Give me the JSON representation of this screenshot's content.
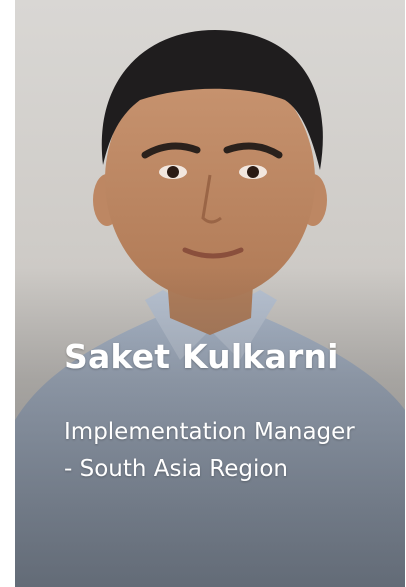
{
  "profile": {
    "name": "Saket Kulkarni",
    "role": "Implementation Manager - South Asia Region"
  }
}
